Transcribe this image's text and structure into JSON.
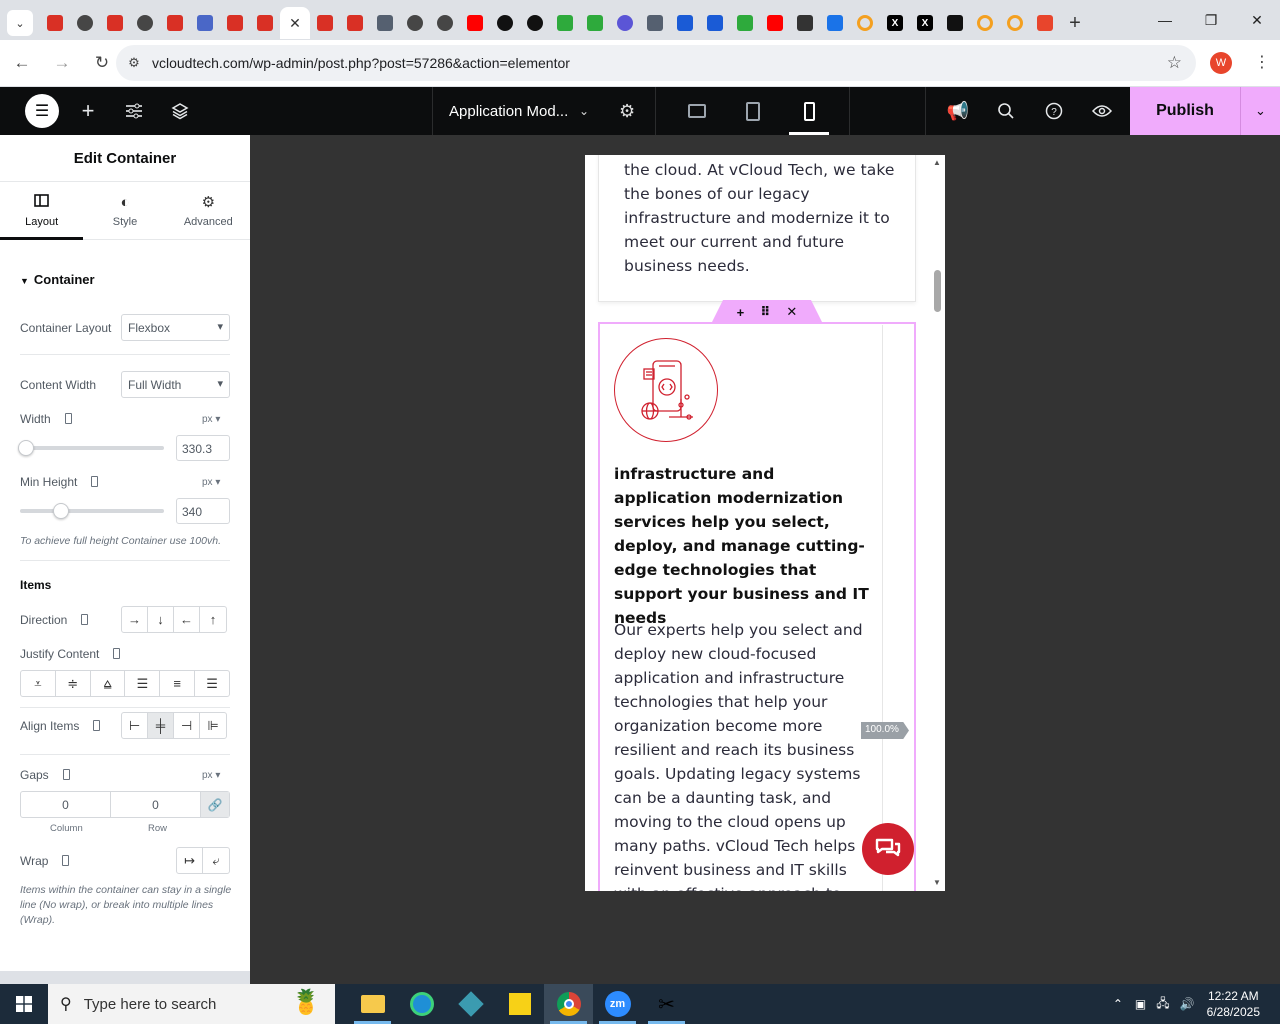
{
  "browser": {
    "tabs": [
      {
        "icon": "wp-red-icon",
        "color": "#d93025"
      },
      {
        "icon": "wordpress-icon",
        "color": "#464646"
      },
      {
        "icon": "wp-red-icon",
        "color": "#d93025"
      },
      {
        "icon": "wordpress-icon",
        "color": "#464646"
      },
      {
        "icon": "wp-red-icon",
        "color": "#d93025"
      },
      {
        "icon": "tool-icon",
        "color": "#4a67c7"
      },
      {
        "icon": "wp-red-icon",
        "color": "#d93025"
      },
      {
        "icon": "wp-red-icon",
        "color": "#d93025"
      },
      {
        "icon": "close-icon",
        "color": "#333333",
        "active": true
      },
      {
        "icon": "wp-red-icon",
        "color": "#d93025"
      },
      {
        "icon": "wp-red-icon",
        "color": "#d93025"
      },
      {
        "icon": "chart-icon",
        "color": "#556070"
      },
      {
        "icon": "wordpress-icon",
        "color": "#464646"
      },
      {
        "icon": "wordpress-icon",
        "color": "#464646"
      },
      {
        "icon": "youtube-icon",
        "color": "#ff0000"
      },
      {
        "icon": "threads-icon",
        "color": "#111111"
      },
      {
        "icon": "threads-icon",
        "color": "#111111"
      },
      {
        "icon": "green-bolt-icon",
        "color": "#2eaa3c"
      },
      {
        "icon": "green-bolt-icon",
        "color": "#2eaa3c"
      },
      {
        "icon": "gear-blue-icon",
        "color": "#5b55d6"
      },
      {
        "icon": "chart-icon",
        "color": "#556070"
      },
      {
        "icon": "grid-blue-icon",
        "color": "#1a5bd6"
      },
      {
        "icon": "grid-blue-icon",
        "color": "#1a5bd6"
      },
      {
        "icon": "green-bolt-icon",
        "color": "#2eaa3c"
      },
      {
        "icon": "youtube-icon",
        "color": "#ff0000"
      },
      {
        "icon": "bank-icon",
        "color": "#333333"
      },
      {
        "icon": "wave-blue-icon",
        "color": "#1a73e8"
      },
      {
        "icon": "ring-icon",
        "color": "#f4a020"
      },
      {
        "icon": "x-icon",
        "color": "#000000"
      },
      {
        "icon": "x-icon",
        "color": "#000000"
      },
      {
        "icon": "dark-square-icon",
        "color": "#111111"
      },
      {
        "icon": "ring-icon",
        "color": "#f4a020"
      },
      {
        "icon": "ring-icon",
        "color": "#f4a020"
      },
      {
        "icon": "slash-red-icon",
        "color": "#e8452c"
      }
    ],
    "url": "vcloudtech.com/wp-admin/post.php?post=57286&action=elementor",
    "profile_initial": "W"
  },
  "editor": {
    "document_title": "Application Mod...",
    "publish_label": "Publish"
  },
  "panel": {
    "title": "Edit Container",
    "tabs": [
      {
        "label": "Layout",
        "icon": "layout-icon"
      },
      {
        "label": "Style",
        "icon": "contrast-icon"
      },
      {
        "label": "Advanced",
        "icon": "gear-icon"
      }
    ],
    "section": "Container",
    "container_layout": {
      "label": "Container Layout",
      "value": "Flexbox"
    },
    "content_width": {
      "label": "Content Width",
      "value": "Full Width"
    },
    "width": {
      "label": "Width",
      "unit": "px",
      "value": "330.3",
      "slider_fraction": 0.0
    },
    "min_height": {
      "label": "Min Height",
      "unit": "px",
      "value": "340",
      "slider_fraction": 0.24
    },
    "min_height_hint": "To achieve full height Container use 100vh.",
    "items_heading": "Items",
    "direction_label": "Direction",
    "justify_label": "Justify Content",
    "align_label": "Align Items",
    "gaps": {
      "label": "Gaps",
      "unit": "px",
      "column": "0",
      "row": "0",
      "column_label": "Column",
      "row_label": "Row"
    },
    "wrap_label": "Wrap",
    "wrap_hint": "Items within the container can stay in a single line (No wrap), or break into multiple lines (Wrap)."
  },
  "preview": {
    "card_text": "the cloud. At vCloud Tech, we take the bones of our legacy infrastructure and modernize it to meet our current and future business needs.",
    "heading": "infrastructure and application modernization services help you select, deploy, and manage cutting-edge technologies that support your business and IT needs",
    "body": "Our experts help you select and deploy new cloud-focused application and infrastructure technologies that help your organization become more resilient and reach its business goals. Updating legacy systems can be a daunting task, and moving to the cloud opens up many paths. vCloud Tech helps reinvent business and IT skills with an effective approach to",
    "zoom_badge": "100.0%",
    "accent_color": "#d0202e",
    "handle_color": "#f0abfc"
  },
  "taskbar": {
    "search_placeholder": "Type here to search",
    "time": "12:22 AM",
    "date": "6/28/2025"
  }
}
